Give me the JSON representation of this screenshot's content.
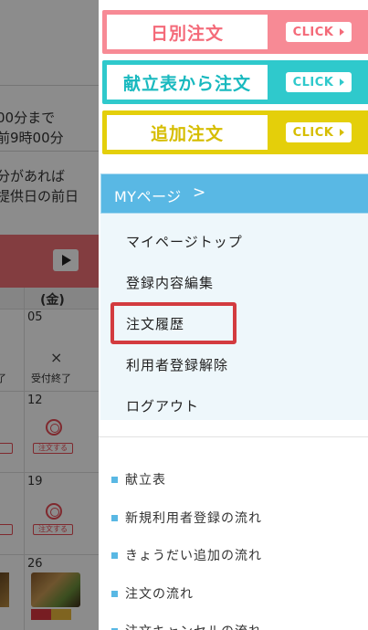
{
  "background": {
    "lines": [
      "00分まで",
      "前9時00分",
      "分があれば",
      "提供日の前日"
    ],
    "day_header": "(金)",
    "dates": [
      "05",
      "12",
      "19",
      "26"
    ],
    "closed_left": "了",
    "closed_label": "受付終了",
    "x_mark": "×",
    "order_label": "注文する"
  },
  "drawer": {
    "order_buttons": [
      {
        "label": "日別注文",
        "click": "CLICK"
      },
      {
        "label": "献立表から注文",
        "click": "CLICK"
      },
      {
        "label": "追加注文",
        "click": "CLICK"
      }
    ],
    "mypage": {
      "title": "MYページ",
      "chevron": ">",
      "items": [
        "マイページトップ",
        "登録内容編集",
        "注文履歴",
        "利用者登録解除",
        "ログアウト"
      ]
    },
    "links": [
      "献立表",
      "新規利用者登録の流れ",
      "きょうだい追加の流れ",
      "注文の流れ",
      "注文キャンセルの流れ"
    ]
  },
  "colors": {
    "daily": "#f78a95",
    "menu": "#2fc9cc",
    "add": "#e4cf0a",
    "mypage": "#59b8e4",
    "highlight": "#d33b3f"
  }
}
